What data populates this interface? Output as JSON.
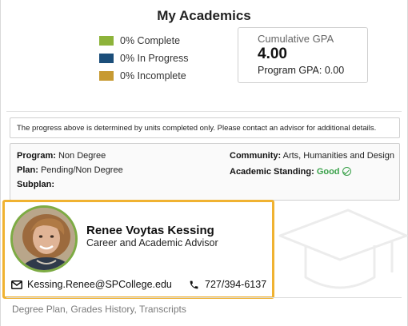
{
  "page": {
    "title": "My Academics"
  },
  "progress_legend": [
    {
      "label": "0% Complete",
      "color": "#8db33a"
    },
    {
      "label": "0% In Progress",
      "color": "#1b4e7a"
    },
    {
      "label": "0% Incomplete",
      "color": "#c79a32"
    }
  ],
  "gpa": {
    "label": "Cumulative GPA",
    "value": "4.00",
    "program": "Program GPA: 0.00"
  },
  "notice": "The progress above is determined by units completed only. Please contact an advisor for additional details.",
  "details": {
    "program_label": "Program:",
    "program_value": "Non Degree",
    "plan_label": "Plan:",
    "plan_value": "Pending/Non Degree",
    "subplan_label": "Subplan:",
    "community_label": "Community:",
    "community_value": "Arts, Humanities and Design",
    "standing_label": "Academic Standing:",
    "standing_value": "Good",
    "standing_color": "#3aa14a"
  },
  "advisor": {
    "name": "Renee Voytas Kessing",
    "role": "Career and Academic Advisor",
    "email": "Kessing.Renee@SPCollege.edu",
    "phone": "727/394-6137",
    "highlight_color": "#f0b231"
  },
  "footer": {
    "links": "Degree Plan, Grades History, Transcripts"
  },
  "icons": {
    "email": "envelope-icon",
    "phone": "phone-icon",
    "standing": "check-circle-icon",
    "watermark": "graduation-cap-icon"
  }
}
